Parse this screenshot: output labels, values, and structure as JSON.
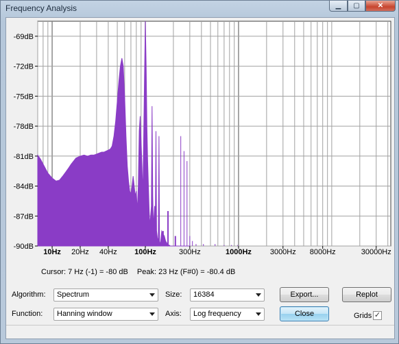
{
  "window": {
    "title": "Frequency Analysis",
    "close_glyph": "✕",
    "max_glyph": "▢",
    "min_glyph": "▁"
  },
  "colors": {
    "spectrum": "#8a3cc6",
    "grid": "#a0a0a0",
    "grid_major": "#808080",
    "plot_bg": "#ffffff"
  },
  "chart_data": {
    "type": "area",
    "xscale": "log",
    "xlim": [
      7,
      43000
    ],
    "ylim": [
      -90,
      -67.5
    ],
    "xticks": [
      "10Hz",
      "20Hz",
      "40Hz",
      "100Hz",
      "300Hz",
      "1000Hz",
      "3000Hz",
      "8000Hz",
      "30000Hz"
    ],
    "xtick_values": [
      10,
      20,
      40,
      100,
      300,
      1000,
      3000,
      8000,
      30000
    ],
    "major_xticks": [
      10,
      100,
      1000
    ],
    "yticks": [
      "-69dB",
      "-72dB",
      "-75dB",
      "-78dB",
      "-81dB",
      "-84dB",
      "-87dB",
      "-90dB"
    ],
    "ytick_values": [
      -69,
      -72,
      -75,
      -78,
      -81,
      -84,
      -87,
      -90
    ],
    "grid": true,
    "series": [
      {
        "x": [
          7,
          7.5,
          8,
          9,
          10,
          11,
          12,
          13,
          14,
          15,
          16,
          18,
          20,
          22,
          24,
          26,
          28,
          30,
          32,
          34,
          36,
          38,
          40,
          42,
          44,
          46,
          48,
          50,
          52,
          54,
          56,
          58,
          60,
          62,
          64,
          66,
          68,
          70,
          72,
          74,
          76,
          78,
          80,
          82,
          84,
          86,
          88,
          90,
          92,
          94,
          96,
          98,
          100,
          102,
          104,
          106,
          108,
          110,
          112,
          114,
          116,
          118,
          120,
          122,
          124,
          126,
          128,
          130,
          132,
          134,
          136,
          138,
          140,
          142,
          144,
          146,
          150,
          155,
          160,
          165,
          170,
          175,
          180,
          185,
          190,
          200,
          210,
          220,
          230,
          240,
          250,
          260,
          270,
          280,
          290,
          300
        ],
        "y": [
          -80.9,
          -81.3,
          -81.8,
          -82.7,
          -83.2,
          -83.5,
          -83.4,
          -83.0,
          -82.6,
          -82.2,
          -81.8,
          -81.2,
          -81.0,
          -80.9,
          -81.0,
          -80.9,
          -80.9,
          -80.8,
          -80.7,
          -80.6,
          -80.6,
          -80.5,
          -80.4,
          -80.3,
          -80.0,
          -79.0,
          -77.5,
          -75.5,
          -73.5,
          -72.0,
          -71.2,
          -72.0,
          -75.0,
          -79.0,
          -82.0,
          -83.5,
          -84.5,
          -84.8,
          -84.0,
          -83.0,
          -84.0,
          -85.0,
          -84.5,
          -86.5,
          -84.0,
          -78.5,
          -77.0,
          -79.5,
          -82.0,
          -85.0,
          -79.0,
          -73.0,
          -67.5,
          -72.0,
          -78.0,
          -81.5,
          -84.0,
          -86.5,
          -88.0,
          -87.0,
          -86.0,
          -76.0,
          -85.0,
          -88.0,
          -87.0,
          -86.0,
          -87.0,
          -78.5,
          -88.5,
          -89.0,
          -89.5,
          -89.2,
          -79.0,
          -89.5,
          -89.8,
          -89.6,
          -88.5,
          -88.8,
          -89.0,
          -89.5,
          -89.7,
          -90.0,
          -89.9,
          -90.0,
          -90.0,
          -90.0,
          -90.0,
          -90.0,
          -90.0,
          -90.0,
          -90.0,
          -90.0,
          -90.0,
          -90.0,
          -90.0,
          -90.0
        ],
        "spikes": [
          {
            "x": 155,
            "y": -88.5
          },
          {
            "x": 175,
            "y": -86.5
          },
          {
            "x": 210,
            "y": -89.0
          }
        ],
        "lines": [
          {
            "x": 240,
            "y": -79.0
          },
          {
            "x": 260,
            "y": -80.5
          },
          {
            "x": 280,
            "y": -81.5
          },
          {
            "x": 300,
            "y": -89.0
          },
          {
            "x": 320,
            "y": -89.5
          },
          {
            "x": 350,
            "y": -89.8
          },
          {
            "x": 420,
            "y": -89.8
          },
          {
            "x": 560,
            "y": -89.8
          },
          {
            "x": 700,
            "y": -89.9
          },
          {
            "x": 840,
            "y": -89.9
          },
          {
            "x": 980,
            "y": -89.9
          }
        ]
      }
    ]
  },
  "status": {
    "cursor": "Cursor: 7 Hz (-1) = -80 dB",
    "peak": "Peak: 23 Hz (F#0) = -80.4 dB"
  },
  "controls": {
    "algorithm_label": "Algorithm:",
    "algorithm_value": "Spectrum",
    "size_label": "Size:",
    "size_value": "16384",
    "function_label": "Function:",
    "function_value": "Hanning window",
    "axis_label": "Axis:",
    "axis_value": "Log frequency",
    "export_label": "Export...",
    "replot_label": "Replot",
    "close_label": "Close",
    "grids_label": "Grids",
    "grids_checked": "✓"
  }
}
